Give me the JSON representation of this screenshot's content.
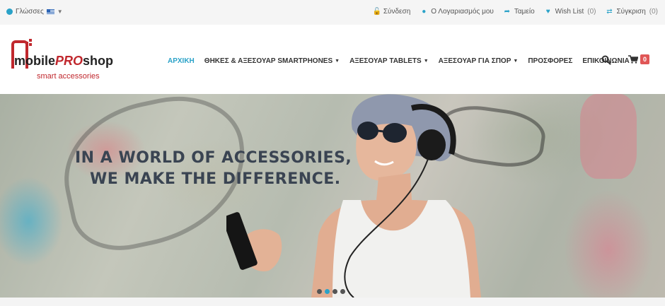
{
  "topbar": {
    "language_label": "Γλώσσες",
    "links": [
      {
        "label": "Σύνδεση",
        "icon": "lock-icon"
      },
      {
        "label": "Ο Λογαριασμός μου",
        "icon": "user-icon"
      },
      {
        "label": "Ταμείο",
        "icon": "share-icon"
      },
      {
        "label": "Wish List",
        "icon": "heart-icon",
        "count": "(0)"
      },
      {
        "label": "Σύγκριση",
        "icon": "compare-icon",
        "count": "(0)"
      }
    ]
  },
  "logo": {
    "word1": "mobile",
    "word2": "PRO",
    "word3": "shop",
    "tagline": "smart accessories"
  },
  "nav": {
    "items": [
      {
        "label": "ΑΡΧΙΚΗ",
        "active": true
      },
      {
        "label": "ΘΗΚΕΣ & ΑΞΕΣΟΥΑΡ SMARTPHONES",
        "dropdown": true
      },
      {
        "label": "ΑΞΕΣΟΥΑΡ TABLETS",
        "dropdown": true
      },
      {
        "label": "ΑΞΕΣΟΥΑΡ ΓΙΑ ΣΠΟΡ",
        "dropdown": true
      },
      {
        "label": "ΠΡΟΣΦΟΡΕΣ"
      },
      {
        "label": "ΕΠΙΚΟΙΝΩΝΙΑ"
      }
    ],
    "cart_count": "0"
  },
  "hero": {
    "line1": "IN A WORLD OF ACCESSORIES,",
    "line2": "WE MAKE THE DIFFERENCE.",
    "slides": 4,
    "active_slide": 2
  },
  "colors": {
    "accent": "#2aa2c8",
    "brand_red": "#c0272d",
    "badge": "#e05656"
  }
}
